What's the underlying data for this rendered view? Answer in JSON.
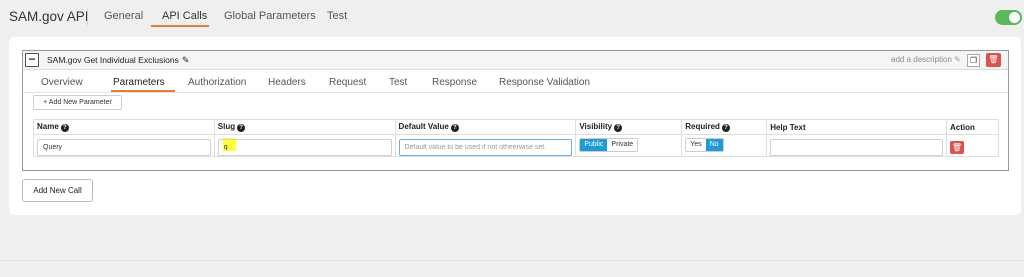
{
  "header": {
    "app_title": "SAM.gov API",
    "tabs": [
      {
        "label": "General"
      },
      {
        "label": "API Calls",
        "active": true
      },
      {
        "label": "Global Parameters"
      },
      {
        "label": "Test"
      }
    ],
    "toggle_on": true
  },
  "call": {
    "name": "SAM.gov Get Individual Exclusions",
    "add_description": "add a description",
    "tabs": [
      {
        "label": "Overview"
      },
      {
        "label": "Parameters",
        "active": true
      },
      {
        "label": "Authorization"
      },
      {
        "label": "Headers"
      },
      {
        "label": "Request"
      },
      {
        "label": "Test"
      },
      {
        "label": "Response"
      },
      {
        "label": "Response Validation"
      }
    ],
    "add_parameter_label": "+ Add New Parameter",
    "table": {
      "columns": [
        "Name",
        "Slug",
        "Default Value",
        "Visibility",
        "Required",
        "Help Text",
        "Action"
      ],
      "rows": [
        {
          "name": "Query",
          "slug": "q",
          "default_value": "",
          "default_placeholder": "Default value to be used if not otheerwise set.",
          "visibility_options": [
            "Public",
            "Private"
          ],
          "visibility_selected": "Public",
          "required_options": [
            "Yes",
            "No"
          ],
          "required_selected": "No",
          "help_text": ""
        }
      ]
    }
  },
  "add_call_label": "Add New Call",
  "colors": {
    "accent": "#e07b39",
    "toggle": "#5cb85c",
    "danger": "#d9534f",
    "selected": "#1e9ad6",
    "highlight": "#ffff3a"
  },
  "icons": [
    "pencil-icon",
    "copy-icon",
    "trash-icon",
    "question-icon",
    "minus-icon"
  ]
}
